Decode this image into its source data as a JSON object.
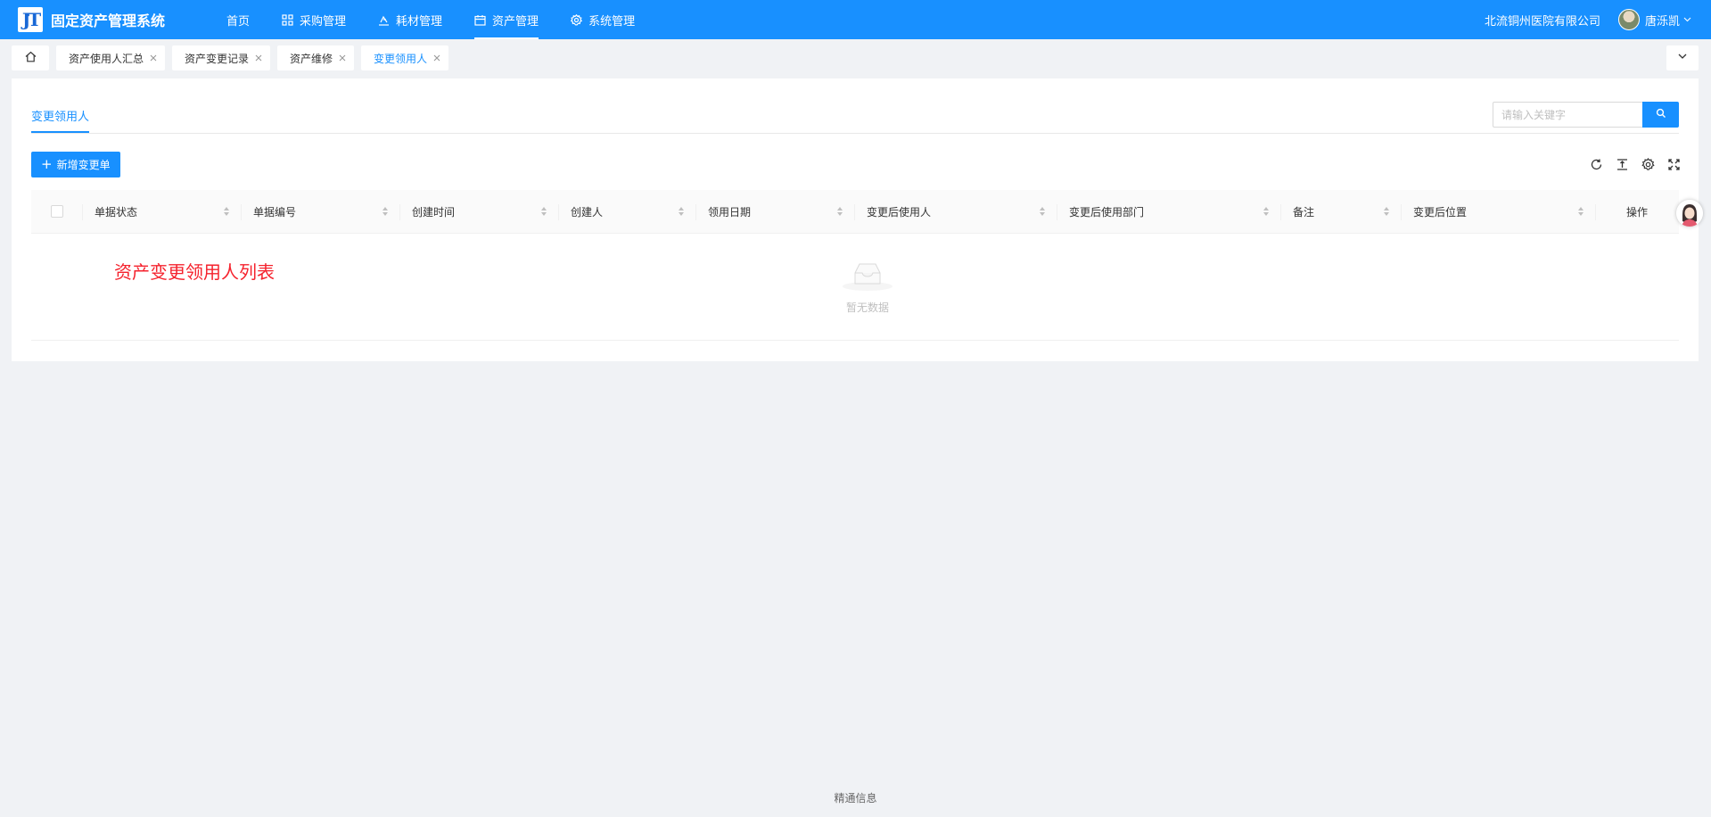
{
  "header": {
    "logo_text": "JT",
    "app_title": "固定资产管理系统",
    "nav": [
      {
        "label": "首页",
        "icon": "none",
        "active": false
      },
      {
        "label": "采购管理",
        "icon": "grid-icon",
        "active": false
      },
      {
        "label": "耗材管理",
        "icon": "tray-icon",
        "active": false
      },
      {
        "label": "资产管理",
        "icon": "calendar-icon",
        "active": true
      },
      {
        "label": "系统管理",
        "icon": "gear-icon",
        "active": false
      }
    ],
    "org_name": "北流铜州医院有限公司",
    "user_name": "唐泺凯"
  },
  "tabs": [
    {
      "label": "资产使用人汇总",
      "active": false
    },
    {
      "label": "资产变更记录",
      "active": false
    },
    {
      "label": "资产维修",
      "active": false
    },
    {
      "label": "变更领用人",
      "active": true
    }
  ],
  "page": {
    "subtab": "变更领用人",
    "search_placeholder": "请输入关键字",
    "add_button": "新增变更单",
    "table": {
      "columns": [
        "单据状态",
        "单据编号",
        "创建时间",
        "创建人",
        "领用日期",
        "变更后使用人",
        "变更后使用部门",
        "备注",
        "变更后位置",
        "操作"
      ],
      "empty_text": "暂无数据"
    },
    "annotation": "资产变更领用人列表"
  },
  "footer": "精通信息",
  "colors": {
    "primary": "#1890ff",
    "annotation": "#f5222d",
    "background": "#f0f2f5"
  }
}
